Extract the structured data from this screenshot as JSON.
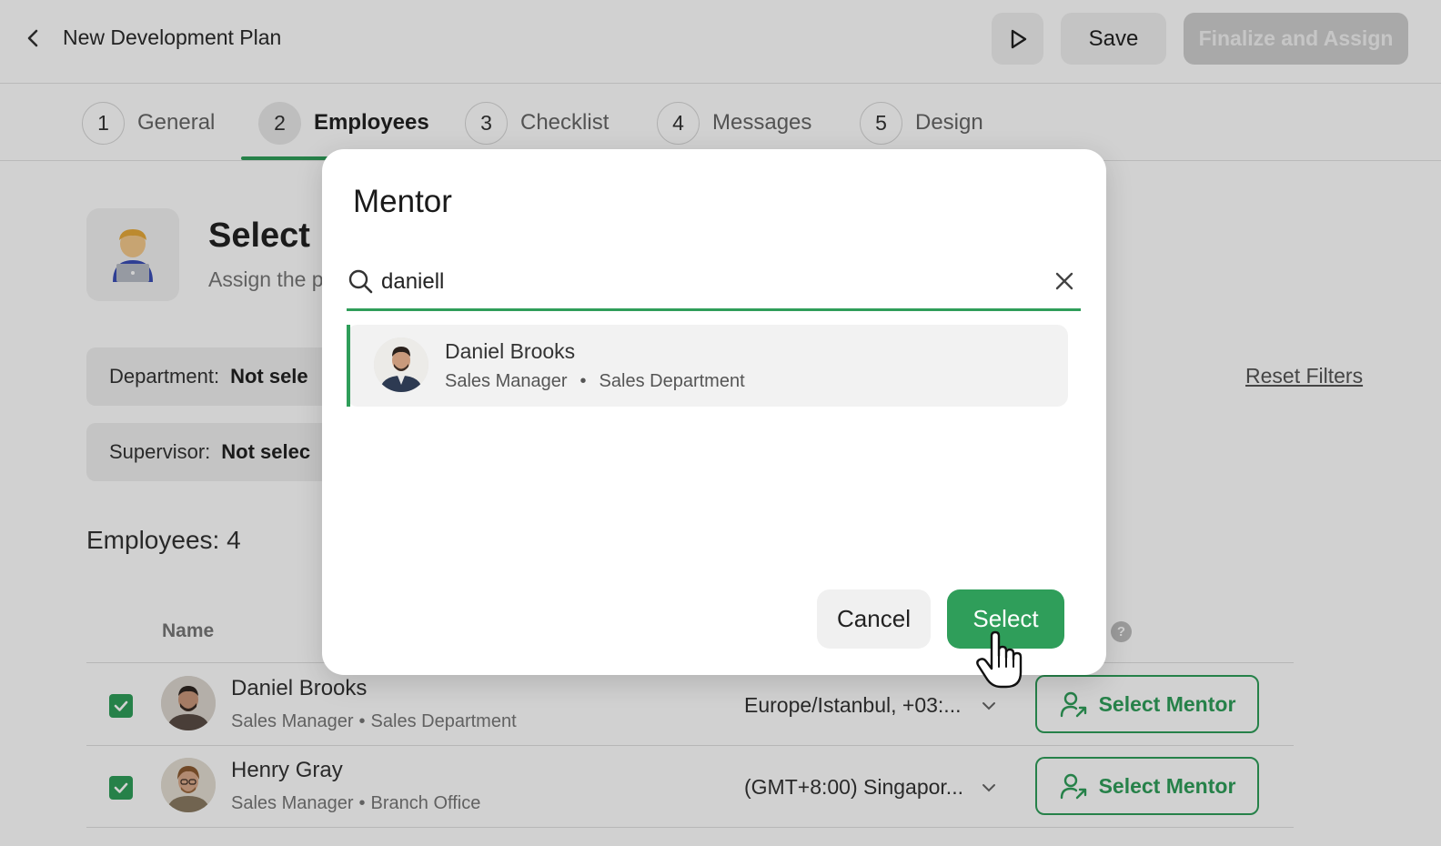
{
  "header": {
    "title": "New Development Plan",
    "save_label": "Save",
    "finalize_label": "Finalize and Assign"
  },
  "tabs": [
    {
      "num": "1",
      "label": "General"
    },
    {
      "num": "2",
      "label": "Employees"
    },
    {
      "num": "3",
      "label": "Checklist"
    },
    {
      "num": "4",
      "label": "Messages"
    },
    {
      "num": "5",
      "label": "Design"
    }
  ],
  "section": {
    "title": "Select E",
    "subtitle": "Assign the p"
  },
  "filters": {
    "department_label": "Department:",
    "department_value": "Not sele",
    "supervisor_label": "Supervisor:",
    "supervisor_value": "Not selec",
    "reset_label": "Reset Filters"
  },
  "employees": {
    "count_label": "Employees: 4",
    "column_name": "Name",
    "rows": [
      {
        "name": "Daniel Brooks",
        "role": "Sales Manager",
        "department": "Sales Department",
        "timezone": "Europe/Istanbul, +03:...",
        "mentor_label": "Select Mentor"
      },
      {
        "name": "Henry Gray",
        "role": "Sales Manager",
        "department": "Branch Office",
        "timezone": "(GMT+8:00) Singapor...",
        "mentor_label": "Select Mentor"
      }
    ]
  },
  "modal": {
    "title": "Mentor",
    "search_value": "daniell",
    "result": {
      "name": "Daniel Brooks",
      "role": "Sales Manager",
      "dot": "•",
      "department": "Sales Department"
    },
    "cancel_label": "Cancel",
    "select_label": "Select"
  },
  "colors": {
    "accent": "#2f9e5a"
  }
}
